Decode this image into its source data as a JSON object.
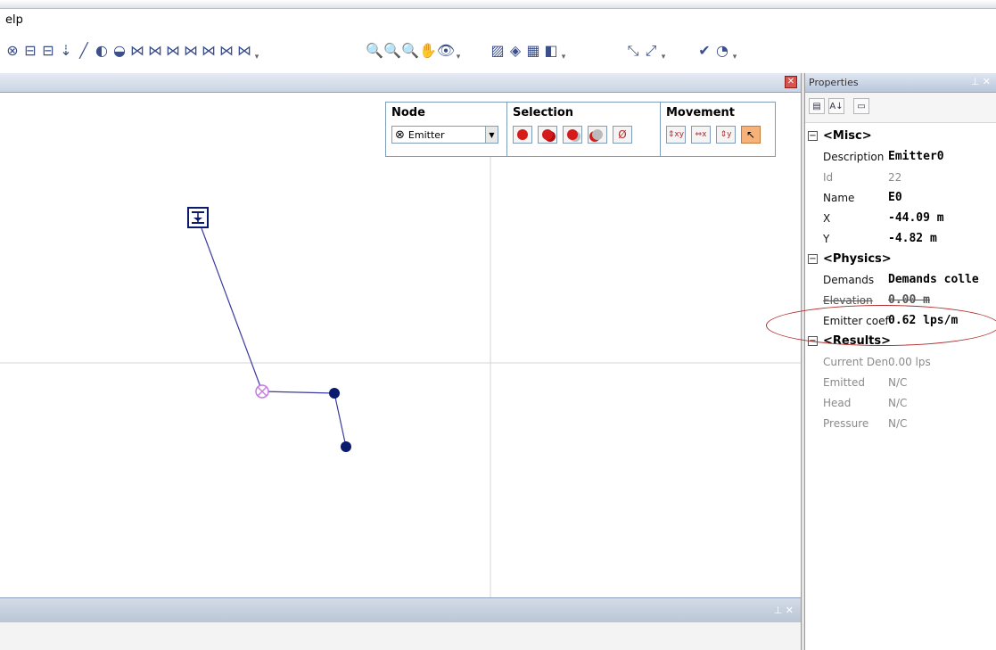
{
  "menu": {
    "help_label": "elp"
  },
  "toolbar": {
    "group1": [
      "⊗",
      "⊟",
      "⊟",
      "⇣",
      "╱",
      "◐",
      "◒",
      "⋈",
      "⋈",
      "⋈",
      "⋈",
      "⋈",
      "⋈",
      "⋈"
    ],
    "group2": [
      "🔍",
      "🔍",
      "🔍",
      "✋",
      "👁"
    ],
    "group3": [
      "▨",
      "◈",
      "▦",
      "◧"
    ],
    "group4": [
      "⤡",
      "⤢"
    ],
    "group5": [
      "✔",
      "◔"
    ]
  },
  "palette": {
    "node_title": "Node",
    "node_selected": "Emitter",
    "node_symbol": "⊗",
    "selection_title": "Selection",
    "movement_title": "Movement"
  },
  "properties": {
    "title": "Properties",
    "misc_label": "<Misc>",
    "physics_label": "<Physics>",
    "results_label": "<Results>",
    "misc": [
      {
        "name": "Description",
        "value": "Emitter0"
      },
      {
        "name": "Id",
        "value": "22"
      },
      {
        "name": "Name",
        "value": "E0"
      },
      {
        "name": "X",
        "value": "-44.09 m"
      },
      {
        "name": "Y",
        "value": "-4.82 m"
      }
    ],
    "physics": [
      {
        "name": "Demands",
        "value": "Demands colle"
      },
      {
        "name": "Elevation",
        "value": "0.00 m"
      },
      {
        "name": "Emitter coef",
        "value": "0.62 lps/m"
      }
    ],
    "results": [
      {
        "name": "Current Den",
        "value": "0.00 lps"
      },
      {
        "name": "Emitted",
        "value": "N/C"
      },
      {
        "name": "Head",
        "value": "N/C"
      },
      {
        "name": "Pressure",
        "value": "N/C"
      }
    ]
  },
  "colors": {
    "network_line": "#3a3aa0",
    "junction": "#0a1a6e",
    "emitter": "#c77adf",
    "annotation": "#b02a2a"
  }
}
